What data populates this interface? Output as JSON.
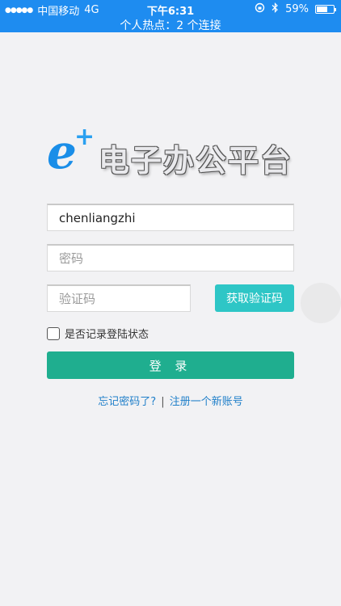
{
  "status_bar": {
    "signal_dots": "●●●●●",
    "carrier": "中国移动",
    "network": "4G",
    "time": "下午6:31",
    "lock_icon": "orientation-lock-icon",
    "bluetooth_icon": "bluetooth-icon",
    "battery_percent": "59%",
    "battery_level": 0.59,
    "hotspot_text": "个人热点：2 个连接",
    "background_color": "#1e8cf0"
  },
  "logo": {
    "e_letter": "e",
    "plus": "+",
    "title": "电子办公平台"
  },
  "form": {
    "username_value": "chenliangzhi",
    "password_placeholder": "密码",
    "code_placeholder": "验证码",
    "get_code_label": "获取验证码",
    "remember_label": "是否记录登陆状态",
    "login_label": "登 录"
  },
  "links": {
    "forgot": "忘记密码了?",
    "separator": "|",
    "register": "注册一个新账号"
  },
  "colors": {
    "accent_teal": "#2ec6c6",
    "login_green": "#1fae8f",
    "link_blue": "#1f7fc9"
  }
}
